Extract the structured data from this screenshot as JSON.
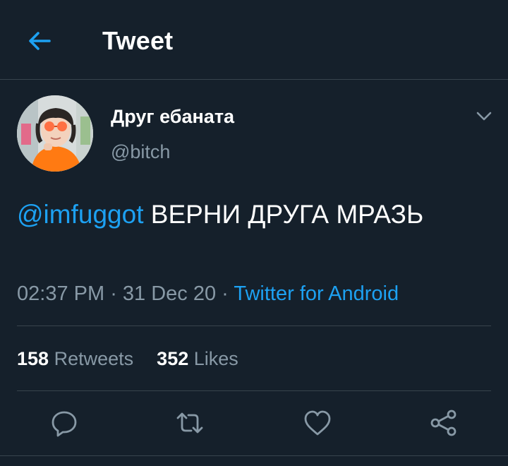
{
  "header": {
    "title": "Tweet",
    "back_icon": "arrow-left-icon"
  },
  "author": {
    "display_name": "Друг ебаната",
    "handle": "@bitch",
    "avatar": "profile-photo"
  },
  "tweet": {
    "mention": "@imfuggot",
    "text": " ВЕРНИ ДРУГА МРАЗЬ",
    "time": "02:37 PM",
    "separator_1": " · ",
    "date": "31 Dec 20",
    "separator_2": " · ",
    "source": "Twitter for Android"
  },
  "stats": {
    "retweets_count": "158",
    "retweets_label": "Retweets",
    "likes_count": "352",
    "likes_label": "Likes"
  },
  "actions": [
    {
      "name": "reply",
      "icon": "reply-icon"
    },
    {
      "name": "retweet",
      "icon": "retweet-icon"
    },
    {
      "name": "like",
      "icon": "heart-icon"
    },
    {
      "name": "share",
      "icon": "share-icon"
    }
  ],
  "colors": {
    "background": "#15202b",
    "accent": "#1da1f2",
    "secondary_text": "#8899a6",
    "divider": "#38444d"
  }
}
